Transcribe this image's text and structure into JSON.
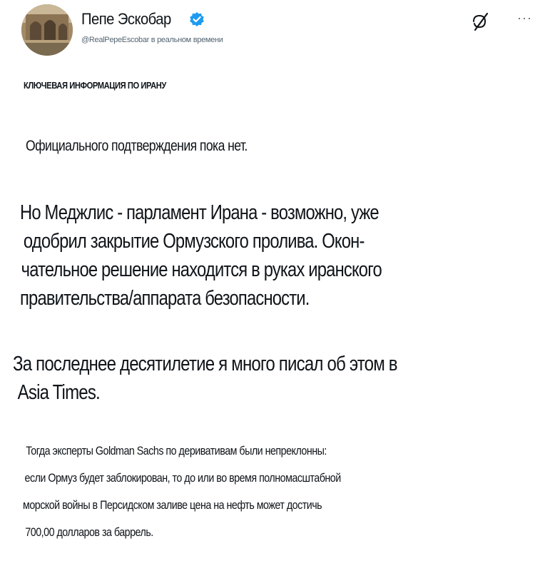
{
  "header": {
    "display_name": "Пепе Эскобар",
    "handle": "@RealPepeEscobar в реальном времени",
    "more_label": "···",
    "verified_color": "#1d9bf0"
  },
  "icons": {
    "verified": "verified-badge-icon",
    "logo": "x-logo-icon",
    "more": "more-icon"
  },
  "tweet": {
    "kicker": "КЛЮЧЕВАЯ ИНФОРМАЦИЯ ПО ИРАНУ",
    "paragraph1": "Официального подтверждения пока нет.",
    "paragraph2": [
      "Но Меджлис - парламент Ирана - возможно, уже",
      "одобрил закрытие Ормузского пролива. Окон-",
      "чательное решение находится в руках иранского",
      "правительства/аппарата безопасности."
    ],
    "paragraph3": [
      "За последнее десятилетие я много писал об этом в",
      "Asia Times."
    ],
    "paragraph4": [
      "Тогда эксперты Goldman Sachs по деривативам были непреклонны:",
      "если Ормуз будет заблокирован, то до или во время полномасштабной",
      "морской войны в Персидском заливе цена на нефть может достичь",
      "700,00 долларов за баррель."
    ]
  }
}
